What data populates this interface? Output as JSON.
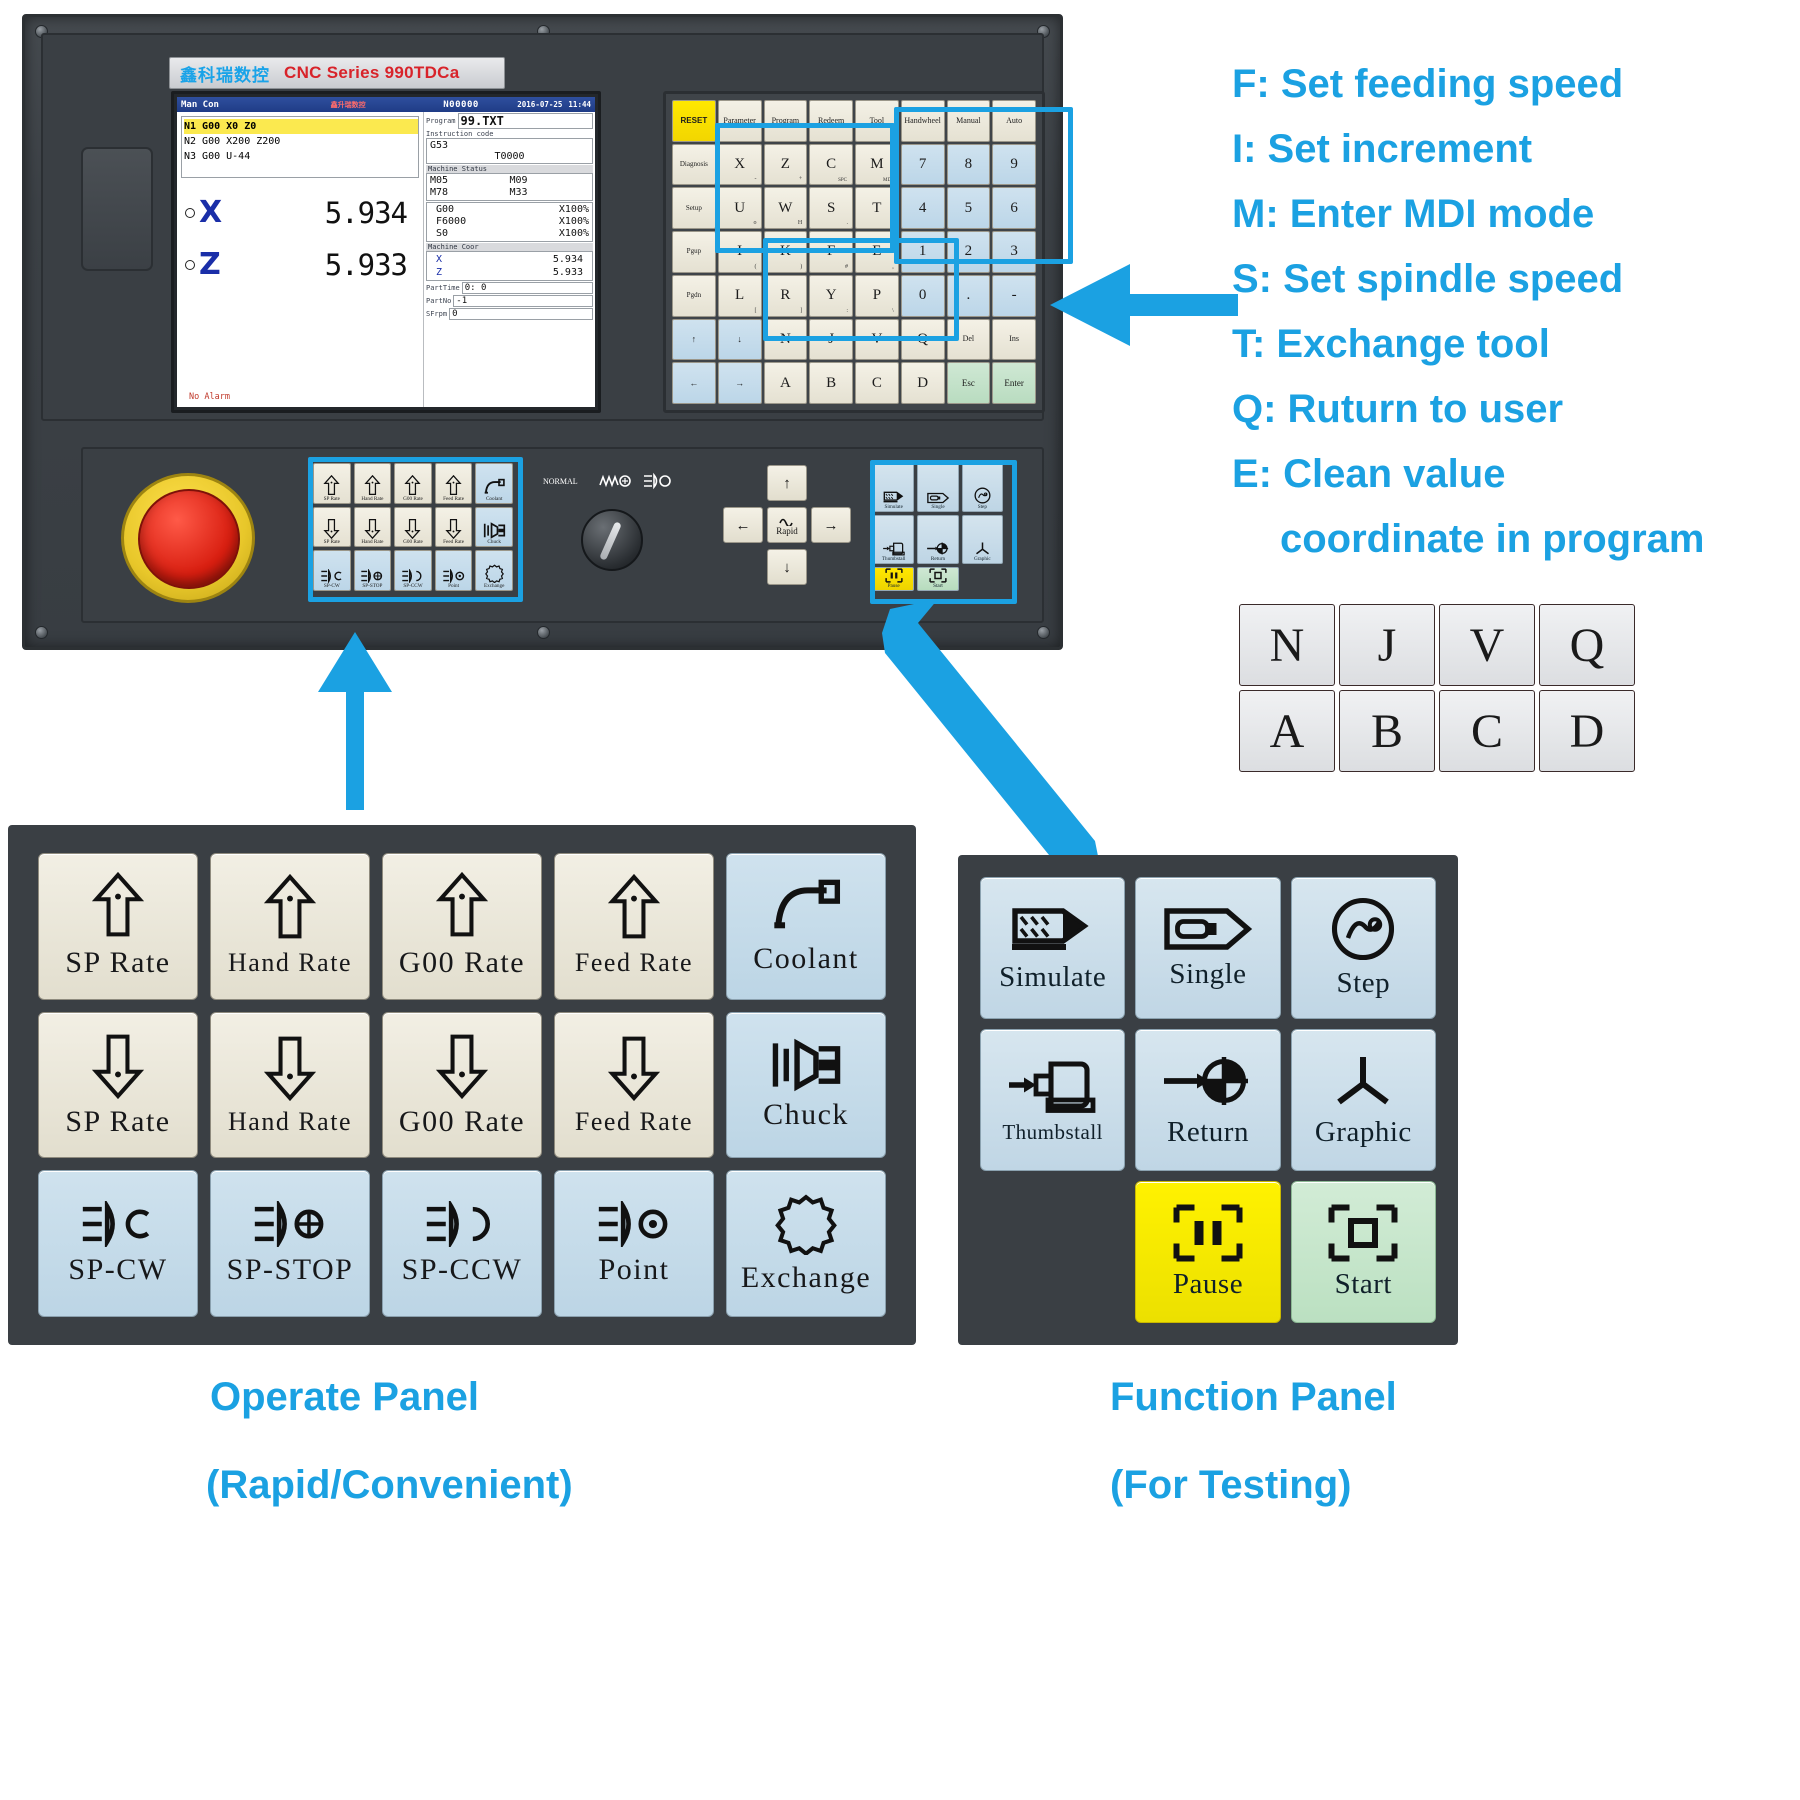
{
  "device": {
    "brand_cn": "鑫科瑞数控",
    "brand_en": "CNC Series 990TDCa"
  },
  "lcd": {
    "titlebar": {
      "mode": "Man Con",
      "watermark": "鑫升瑞数控",
      "program_no": "N00000",
      "date": "2016-07-25",
      "time": "11:44"
    },
    "program_lines": [
      "N1 G00 X0 Z0",
      "N2 G00 X200 Z200",
      "N3 G00 U-44"
    ],
    "axes": [
      {
        "name": "X",
        "value": "5.934"
      },
      {
        "name": "Z",
        "value": "5.933"
      }
    ],
    "alarm": "No Alarm",
    "program_label": "Program",
    "program_value": "99.TXT",
    "instruction_label": "Instruction code",
    "instruction_code": "G53",
    "tool_code": "T0000",
    "machine_status_label": "Machine Status",
    "m_codes": [
      "M05",
      "M09",
      "M78",
      "M33"
    ],
    "overrides": [
      {
        "code": "G00",
        "pct": "X100%"
      },
      {
        "code": "F6000",
        "pct": "X100%"
      },
      {
        "code": "S0",
        "pct": "X100%"
      }
    ],
    "machine_coor_label": "Machine Coor",
    "machine_coor": [
      {
        "axis": "X",
        "value": "5.934"
      },
      {
        "axis": "Z",
        "value": "5.933"
      }
    ],
    "parttime_label": "PartTime",
    "parttime_value": "0: 0",
    "partno_label": "PartNo",
    "partno_value": "-1",
    "sfrpm_label": "SFrpm",
    "sfrpm_value": "0"
  },
  "keyboard": {
    "rows": [
      [
        {
          "label": "RESET",
          "kind": "reset"
        },
        {
          "label": "Parameter",
          "kind": "fn"
        },
        {
          "label": "Program",
          "kind": "fn"
        },
        {
          "label": "Redeem",
          "kind": "fn"
        },
        {
          "label": "Tool",
          "kind": "fn"
        },
        {
          "label": "Handwheel",
          "kind": "fn"
        },
        {
          "label": "Manual",
          "kind": "fn"
        },
        {
          "label": "Auto",
          "kind": "fn"
        }
      ],
      [
        {
          "label": "Diagnosis",
          "kind": "tiny"
        },
        {
          "label": "X",
          "kind": "big",
          "sub": "-"
        },
        {
          "label": "Z",
          "kind": "big",
          "sub": "+"
        },
        {
          "label": "C",
          "kind": "big",
          "subc": "SPC"
        },
        {
          "label": "M",
          "kind": "big",
          "subc": "MDI"
        },
        {
          "label": "7",
          "kind": "num"
        },
        {
          "label": "8",
          "kind": "num"
        },
        {
          "label": "9",
          "kind": "num"
        }
      ],
      [
        {
          "label": "Setup",
          "kind": "tiny"
        },
        {
          "label": "U",
          "kind": "big",
          "sub": "o"
        },
        {
          "label": "W",
          "kind": "big",
          "sub": "H"
        },
        {
          "label": "S",
          "kind": "big",
          "sub": "."
        },
        {
          "label": "T",
          "kind": "big",
          "sub": "-"
        },
        {
          "label": "4",
          "kind": "num"
        },
        {
          "label": "5",
          "kind": "num"
        },
        {
          "label": "6",
          "kind": "num"
        }
      ],
      [
        {
          "label": "Pgup",
          "kind": "tiny"
        },
        {
          "label": "I",
          "kind": "big",
          "sub": "("
        },
        {
          "label": "K",
          "kind": "big",
          "sub": ")"
        },
        {
          "label": "F",
          "kind": "big",
          "sub": "#"
        },
        {
          "label": "E",
          "kind": "big",
          "sub": ","
        },
        {
          "label": "1",
          "kind": "num"
        },
        {
          "label": "2",
          "kind": "num"
        },
        {
          "label": "3",
          "kind": "num"
        }
      ],
      [
        {
          "label": "Pgdn",
          "kind": "tiny"
        },
        {
          "label": "L",
          "kind": "big",
          "sub": "["
        },
        {
          "label": "R",
          "kind": "big",
          "sub": "]"
        },
        {
          "label": "Y",
          "kind": "big",
          "sub": ":"
        },
        {
          "label": "P",
          "kind": "big",
          "sub": "\\"
        },
        {
          "label": "0",
          "kind": "num"
        },
        {
          "label": ".",
          "kind": "num"
        },
        {
          "label": "-",
          "kind": "num"
        }
      ],
      [
        {
          "label": "↑",
          "kind": "blue"
        },
        {
          "label": "↓",
          "kind": "blue"
        },
        {
          "label": "N",
          "kind": "big"
        },
        {
          "label": "J",
          "kind": "big"
        },
        {
          "label": "V",
          "kind": "big"
        },
        {
          "label": "Q",
          "kind": "big"
        },
        {
          "label": "Del",
          "kind": "fn"
        },
        {
          "label": "Ins",
          "kind": "fn"
        }
      ],
      [
        {
          "label": "←",
          "kind": "blue"
        },
        {
          "label": "→",
          "kind": "blue"
        },
        {
          "label": "A",
          "kind": "big"
        },
        {
          "label": "B",
          "kind": "big"
        },
        {
          "label": "C",
          "kind": "big"
        },
        {
          "label": "D",
          "kind": "big"
        },
        {
          "label": "Esc",
          "kind": "green"
        },
        {
          "label": "Enter",
          "kind": "green"
        }
      ]
    ]
  },
  "mode_selector": {
    "labels": [
      "NORMAL",
      "feed-wave-icon",
      "spindle-icon"
    ]
  },
  "jog": {
    "up": "↑",
    "down": "↓",
    "left": "←",
    "right": "→",
    "center": "Rapid"
  },
  "operate_panel": {
    "caption_line1": "Operate Panel",
    "caption_line2": "(Rapid/Convenient)",
    "buttons": [
      {
        "label": "SP Rate",
        "icon": "arrow-up-icon",
        "style": "cream"
      },
      {
        "label": "Hand Rate",
        "icon": "arrow-up-icon",
        "style": "cream"
      },
      {
        "label": "G00 Rate",
        "icon": "arrow-up-icon",
        "style": "cream"
      },
      {
        "label": "Feed Rate",
        "icon": "arrow-up-icon",
        "style": "cream"
      },
      {
        "label": "Coolant",
        "icon": "coolant-tap-icon",
        "style": "blue"
      },
      {
        "label": "SP Rate",
        "icon": "arrow-down-icon",
        "style": "cream"
      },
      {
        "label": "Hand Rate",
        "icon": "arrow-down-icon",
        "style": "cream"
      },
      {
        "label": "G00 Rate",
        "icon": "arrow-down-icon",
        "style": "cream"
      },
      {
        "label": "Feed Rate",
        "icon": "arrow-down-icon",
        "style": "cream"
      },
      {
        "label": "Chuck",
        "icon": "chuck-icon",
        "style": "blue"
      },
      {
        "label": "SP-CW",
        "icon": "spindle-cw-icon",
        "style": "blue"
      },
      {
        "label": "SP-STOP",
        "icon": "spindle-stop-icon",
        "style": "blue"
      },
      {
        "label": "SP-CCW",
        "icon": "spindle-ccw-icon",
        "style": "blue"
      },
      {
        "label": "Point",
        "icon": "spindle-point-icon",
        "style": "blue"
      },
      {
        "label": "Exchange",
        "icon": "gear-exchange-icon",
        "style": "blue"
      }
    ]
  },
  "function_panel": {
    "caption_line1": "Function Panel",
    "caption_line2": "(For Testing)",
    "buttons": [
      {
        "label": "Simulate",
        "icon": "simulate-icon",
        "style": "blue"
      },
      {
        "label": "Single",
        "icon": "single-block-icon",
        "style": "blue"
      },
      {
        "label": "Step",
        "icon": "step-icon",
        "style": "blue"
      },
      {
        "label": "Thumbstall",
        "icon": "thumbstall-icon",
        "style": "blue"
      },
      {
        "label": "Return",
        "icon": "return-origin-icon",
        "style": "blue"
      },
      {
        "label": "Graphic",
        "icon": "graphic-axes-icon",
        "style": "blue"
      },
      {
        "label": "Pause",
        "icon": "pause-frame-icon",
        "style": "yellow"
      },
      {
        "label": "Start",
        "icon": "start-frame-icon",
        "style": "green"
      }
    ]
  },
  "hints": {
    "lines": [
      "F: Set feeding speed",
      "I: Set increment",
      "M: Enter MDI mode",
      "S: Set spindle speed",
      "T: Exchange tool",
      "Q: Ruturn to user",
      "E: Clean value",
      "coordinate in program"
    ]
  },
  "key_inset": {
    "rows": [
      [
        "N",
        "J",
        "V",
        "Q"
      ],
      [
        "A",
        "B",
        "C",
        "D"
      ]
    ]
  },
  "colors": {
    "accent": "#1ba1e2",
    "brand_red": "#d8232a",
    "brand_cyan": "#1aa3e8",
    "estop_red": "#d81e10",
    "pause_yellow": "#fff200"
  }
}
